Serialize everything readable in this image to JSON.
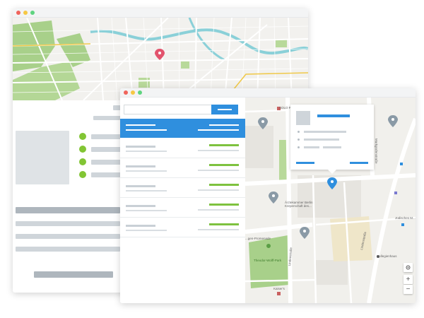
{
  "colors": {
    "accent_blue": "#2f8fde",
    "accent_green": "#7ec23f",
    "bullet_green": "#82c534",
    "marker_pink": "#e2536c",
    "marker_gray": "#8a9aa6",
    "park_green": "#a8d08a",
    "water_blue": "#8ad0d8"
  },
  "icons": {
    "location_pin": "map-pin-icon",
    "locate": "crosshair-icon",
    "zoom_in": "plus-icon",
    "zoom_out": "minus-icon"
  },
  "search": {
    "placeholder": ""
  },
  "map_labels": {
    "top": "SOLO REAL A",
    "building": "Ärztekammer Berlin Körperschaft des...",
    "promenade": "...gen-Promenade",
    "park": "Theodor-Wolff-Park",
    "street_vertical": "Lindenstraße",
    "street_diagonal": "Lindenstraße",
    "street_left": "Markgrafenstraße",
    "museum": "Jüdisches M...",
    "college": "Collegienhaus",
    "small1": "Kaiser's"
  },
  "map_controls": {
    "zoom_in": "+",
    "zoom_out": "−"
  }
}
